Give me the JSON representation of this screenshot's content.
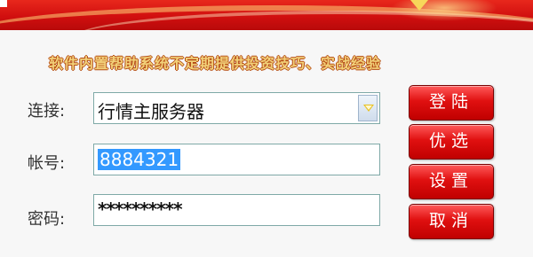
{
  "tagline": "软件内置帮助系统不定期提供投资技巧、实战经验",
  "form": {
    "server_label": "连接:",
    "server_value": "行情主服务器",
    "account_label": "帐号:",
    "account_value": "8884321",
    "password_label": "密码:",
    "password_value": "**********"
  },
  "buttons": {
    "login": "登陆",
    "preferences": "优选",
    "settings": "设置",
    "cancel": "取消"
  },
  "icons": {
    "dropdown": "chevron-down-icon"
  },
  "colors": {
    "banner": "#d10f0f",
    "button": "#e01010",
    "tagline": "#f2d17a",
    "selection": "#3399ff"
  }
}
